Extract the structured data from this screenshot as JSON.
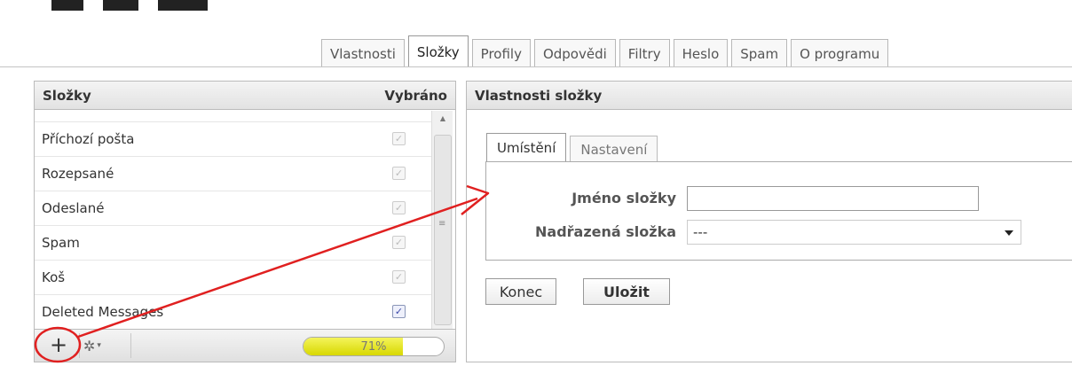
{
  "tabs": [
    {
      "label": "Vlastnosti",
      "active": false
    },
    {
      "label": "Složky",
      "active": true
    },
    {
      "label": "Profily",
      "active": false
    },
    {
      "label": "Odpovědi",
      "active": false
    },
    {
      "label": "Filtry",
      "active": false
    },
    {
      "label": "Heslo",
      "active": false
    },
    {
      "label": "Spam",
      "active": false
    },
    {
      "label": "O programu",
      "active": false
    }
  ],
  "folders_panel": {
    "title": "Složky",
    "selected_header": "Vybráno",
    "items": [
      {
        "name": "Příchozí pošta",
        "checked": true,
        "enabled": false
      },
      {
        "name": "Rozepsané",
        "checked": true,
        "enabled": false
      },
      {
        "name": "Odeslané",
        "checked": true,
        "enabled": false
      },
      {
        "name": "Spam",
        "checked": true,
        "enabled": false
      },
      {
        "name": "Koš",
        "checked": true,
        "enabled": false
      },
      {
        "name": "Deleted Messages",
        "checked": true,
        "enabled": true
      }
    ],
    "footer": {
      "add_icon": "plus-icon",
      "add_glyph": "+",
      "settings_icon": "gear-icon",
      "settings_glyph": "✲",
      "settings_caret": "▾",
      "quota_percent": 71,
      "quota_label": "71%"
    }
  },
  "properties_panel": {
    "title": "Vlastnosti složky",
    "inner_tabs": [
      {
        "label": "Umístění",
        "active": true
      },
      {
        "label": "Nastavení",
        "active": false
      }
    ],
    "form": {
      "name_label": "Jméno složky",
      "name_value": "",
      "parent_label": "Nadřazená složka",
      "parent_selected": "---"
    },
    "buttons": {
      "close_label": "Konec",
      "save_label": "Uložit"
    }
  },
  "colors": {
    "annotation_red": "#e02020",
    "quota_fill": "#e6e600",
    "checkbox_checked": "#3b48a8"
  }
}
